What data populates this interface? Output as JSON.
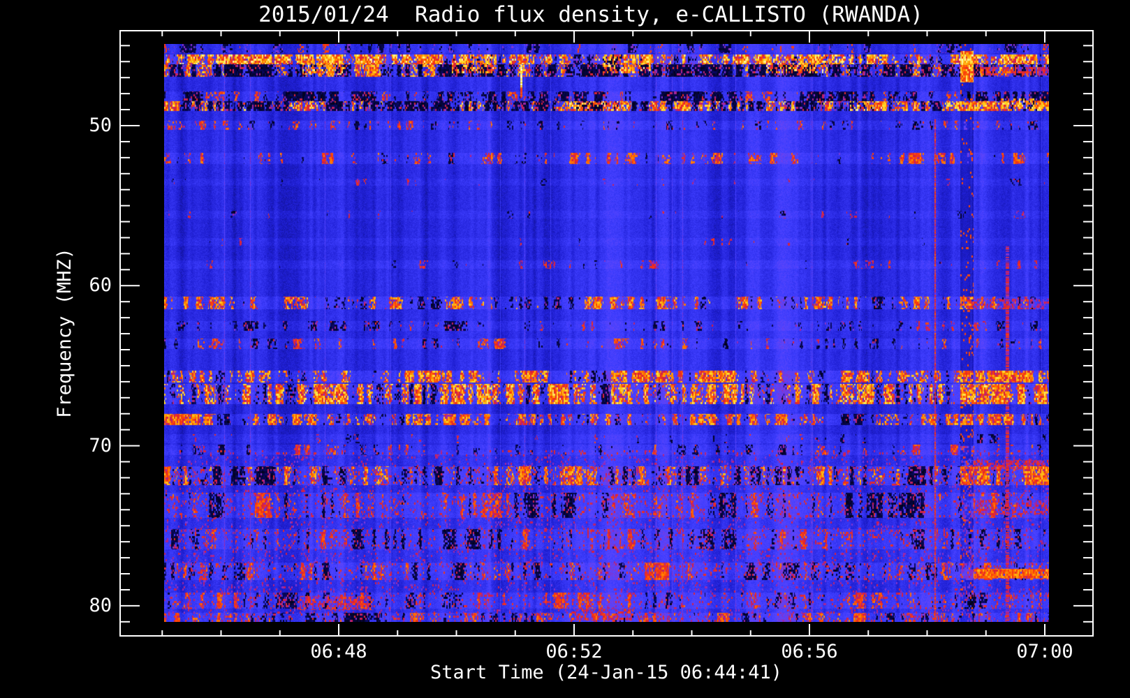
{
  "window": {
    "background": "#000000",
    "foreground": "#ffffff"
  },
  "chart_data": {
    "type": "heatmap",
    "title": "2015/01/24  Radio flux density, e-CALLISTO (RWANDA)",
    "xlabel": "Start Time (24-Jan-15 06:44:41)",
    "ylabel": "Frequency (MHZ)",
    "legend": "none",
    "grid": "off",
    "x_axis": {
      "major_ticks": [
        {
          "label": "06:48",
          "frac": 0.2247
        },
        {
          "label": "06:52",
          "frac": 0.46662
        },
        {
          "label": "06:56",
          "frac": 0.70854
        },
        {
          "label": "07:00",
          "frac": 0.95046
        }
      ],
      "minor_step_frac": 0.060481,
      "minors_per_major": 4
    },
    "y_axis": {
      "major_ticks": [
        {
          "label": "50",
          "frac": 0.15686
        },
        {
          "label": "60",
          "frac": 0.42133
        },
        {
          "label": "70",
          "frac": 0.6858
        },
        {
          "label": "80",
          "frac": 0.95027
        }
      ],
      "minor_step_frac": 0.026447,
      "minors_per_major": 10,
      "direction": "increasing-downward"
    },
    "freq_range_mhz": [
      44.9,
      81.0
    ],
    "colormap_stops": [
      [
        0.0,
        [
          0,
          0,
          0
        ]
      ],
      [
        0.12,
        [
          8,
          8,
          100
        ]
      ],
      [
        0.3,
        [
          30,
          30,
          210
        ]
      ],
      [
        0.45,
        [
          62,
          62,
          255
        ]
      ],
      [
        0.55,
        [
          95,
          70,
          250
        ]
      ],
      [
        0.62,
        [
          150,
          40,
          180
        ]
      ],
      [
        0.7,
        [
          212,
          30,
          66
        ]
      ],
      [
        0.78,
        [
          252,
          62,
          8
        ]
      ],
      [
        0.86,
        [
          255,
          142,
          0
        ]
      ],
      [
        0.93,
        [
          255,
          222,
          40
        ]
      ],
      [
        1.0,
        [
          255,
          255,
          232
        ]
      ]
    ],
    "noise": {
      "base": 0.37,
      "col_amp": 0.12,
      "pix_amp": 0.1,
      "fog_start_mhz": 70.3,
      "fog_prob": 0.1,
      "fog_val": 0.57,
      "seed": 7
    },
    "rfi_bands": [
      {
        "mhz": [
          44.9,
          45.45
        ],
        "dark": 0.3,
        "hot": 0.1,
        "heat": 0.5,
        "lift": 0.03
      },
      {
        "mhz": [
          45.55,
          46.15
        ],
        "dark": 0.2,
        "hot": 0.52,
        "heat": 0.95,
        "lift": 0.1
      },
      {
        "mhz": [
          46.15,
          46.95
        ],
        "dark": 0.55,
        "hot": 0.28,
        "heat": 0.85,
        "lift": 0.07
      },
      {
        "mhz": [
          47.85,
          48.45
        ],
        "dark": 0.45,
        "hot": 0.16,
        "heat": 0.6,
        "lift": 0.05
      },
      {
        "mhz": [
          48.45,
          49.05
        ],
        "dark": 0.5,
        "hot": 0.34,
        "heat": 0.9,
        "lift": 0.07
      },
      {
        "mhz": [
          49.7,
          50.25
        ],
        "dark": 0.16,
        "hot": 0.28,
        "heat": 0.62,
        "lift": 0.05
      },
      {
        "mhz": [
          51.7,
          52.4
        ],
        "dark": 0.14,
        "hot": 0.26,
        "heat": 0.66,
        "lift": 0.05
      },
      {
        "mhz": [
          53.3,
          53.75
        ],
        "dark": 0.08,
        "hot": 0.09,
        "heat": 0.4,
        "lift": 0.03
      },
      {
        "mhz": [
          55.3,
          55.8
        ],
        "dark": 0.08,
        "hot": 0.1,
        "heat": 0.42,
        "lift": 0.03
      },
      {
        "mhz": [
          57.0,
          57.5
        ],
        "dark": 0.08,
        "hot": 0.1,
        "heat": 0.42,
        "lift": 0.03
      },
      {
        "mhz": [
          58.4,
          58.95
        ],
        "dark": 0.1,
        "hot": 0.13,
        "heat": 0.48,
        "lift": 0.04
      },
      {
        "mhz": [
          60.7,
          61.45
        ],
        "dark": 0.18,
        "hot": 0.38,
        "heat": 0.8,
        "lift": 0.07
      },
      {
        "mhz": [
          62.2,
          62.8
        ],
        "dark": 0.28,
        "hot": 0.12,
        "heat": 0.5,
        "lift": 0.04
      },
      {
        "mhz": [
          63.3,
          63.95
        ],
        "dark": 0.16,
        "hot": 0.24,
        "heat": 0.64,
        "lift": 0.05
      },
      {
        "mhz": [
          65.3,
          66.05
        ],
        "dark": 0.2,
        "hot": 0.4,
        "heat": 0.85,
        "lift": 0.08
      },
      {
        "mhz": [
          66.15,
          67.4
        ],
        "dark": 0.24,
        "hot": 0.48,
        "heat": 0.9,
        "lift": 0.09
      },
      {
        "mhz": [
          68.0,
          68.7
        ],
        "dark": 0.26,
        "hot": 0.38,
        "heat": 0.8,
        "lift": 0.07
      },
      {
        "mhz": [
          69.3,
          69.85
        ],
        "dark": 0.14,
        "hot": 0.12,
        "heat": 0.5,
        "lift": 0.04
      },
      {
        "mhz": [
          69.95,
          70.6
        ],
        "dark": 0.18,
        "hot": 0.2,
        "heat": 0.6,
        "lift": 0.05
      },
      {
        "mhz": [
          71.3,
          72.45
        ],
        "dark": 0.32,
        "hot": 0.36,
        "heat": 0.8,
        "lift": 0.08
      },
      {
        "mhz": [
          72.95,
          74.5
        ],
        "dark": 0.28,
        "hot": 0.22,
        "heat": 0.62,
        "lift": 0.07
      },
      {
        "mhz": [
          75.2,
          76.5
        ],
        "dark": 0.26,
        "hot": 0.2,
        "heat": 0.58,
        "lift": 0.06
      },
      {
        "mhz": [
          77.3,
          78.4
        ],
        "dark": 0.28,
        "hot": 0.26,
        "heat": 0.64,
        "lift": 0.07
      },
      {
        "mhz": [
          79.2,
          80.2
        ],
        "dark": 0.24,
        "hot": 0.24,
        "heat": 0.6,
        "lift": 0.06
      },
      {
        "mhz": [
          80.45,
          81.0
        ],
        "dark": 0.24,
        "hot": 0.3,
        "heat": 0.66,
        "lift": 0.06
      }
    ],
    "hotspots": [
      {
        "x": [
          0.155,
          0.205
        ],
        "mhz": [
          45.55,
          46.8
        ]
      },
      {
        "x": [
          0.325,
          0.375
        ],
        "mhz": [
          45.55,
          46.7
        ]
      },
      {
        "x": [
          0.495,
          0.55
        ],
        "mhz": [
          45.55,
          46.7
        ]
      },
      {
        "x": [
          0.455,
          0.525
        ],
        "mhz": [
          48.45,
          49.05
        ]
      },
      {
        "x": [
          0.68,
          0.75
        ],
        "mhz": [
          45.55,
          46.7
        ]
      },
      {
        "x": [
          0.775,
          0.815
        ],
        "mhz": [
          48.45,
          49.05
        ]
      },
      {
        "x": [
          0.945,
          0.995
        ],
        "mhz": [
          48.3,
          49.05
        ]
      }
    ],
    "patches": [
      {
        "x": [
          0.15,
          0.235
        ],
        "mhz": [
          79.4,
          80.3
        ],
        "val": 0.7,
        "prob": 0.5
      },
      {
        "x": [
          0.46,
          0.53
        ],
        "mhz": [
          80.2,
          80.95
        ],
        "val": 0.7,
        "prob": 0.5
      },
      {
        "x": [
          0.9,
          1.0
        ],
        "mhz": [
          77.7,
          78.3
        ],
        "val": 0.8,
        "prob": 0.95
      },
      {
        "x": [
          0.9,
          1.0
        ],
        "mhz": [
          70.9,
          71.5
        ],
        "val": 0.68,
        "prob": 0.6
      },
      {
        "x": [
          0.9,
          1.0
        ],
        "mhz": [
          73.4,
          74.3
        ],
        "val": 0.66,
        "prob": 0.5
      },
      {
        "x": [
          0.9,
          1.0
        ],
        "mhz": [
          46.3,
          46.85
        ],
        "val": 0.7,
        "prob": 0.6
      },
      {
        "x": [
          0.9,
          1.0
        ],
        "mhz": [
          60.8,
          61.45
        ],
        "val": 0.66,
        "prob": 0.5
      }
    ],
    "vertical_features": [
      {
        "type": "spike",
        "x": [
          0.402,
          0.4045
        ],
        "mhz": [
          46.2,
          48.2
        ]
      },
      {
        "type": "thin-line",
        "x": [
          0.87,
          0.8718
        ],
        "mhz": [
          49.6,
          81.0
        ]
      },
      {
        "type": "disturbed",
        "x": [
          0.899,
          0.914
        ],
        "mhz": [
          44.9,
          81.0
        ]
      },
      {
        "type": "red-line",
        "x": [
          0.951,
          0.9545
        ],
        "mhz": [
          57.5,
          81.0
        ]
      }
    ]
  }
}
